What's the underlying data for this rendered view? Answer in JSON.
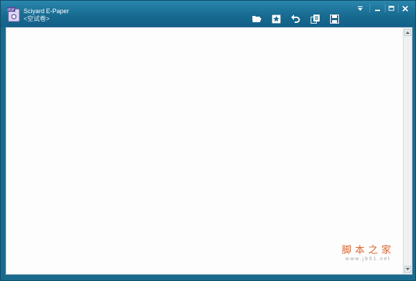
{
  "window": {
    "title": "Sciyard E-Paper",
    "subtitle": "<空试卷>",
    "app_icon_text": "PDF"
  },
  "toolbar": {
    "buttons": [
      {
        "name": "open-folder-icon"
      },
      {
        "name": "bookmark-star-icon"
      },
      {
        "name": "undo-icon"
      },
      {
        "name": "copy-pages-icon"
      },
      {
        "name": "save-disk-icon"
      }
    ]
  },
  "window_controls": {
    "menu": "dropdown-icon",
    "minimize": "minimize-icon",
    "maximize": "maximize-icon",
    "close": "close-icon"
  },
  "watermark": {
    "main": "脚本之家",
    "url": "www.jb51.net"
  },
  "colors": {
    "titlebar": "#17698f",
    "frame": "#1a6a8e",
    "watermark": "#d9622b"
  }
}
